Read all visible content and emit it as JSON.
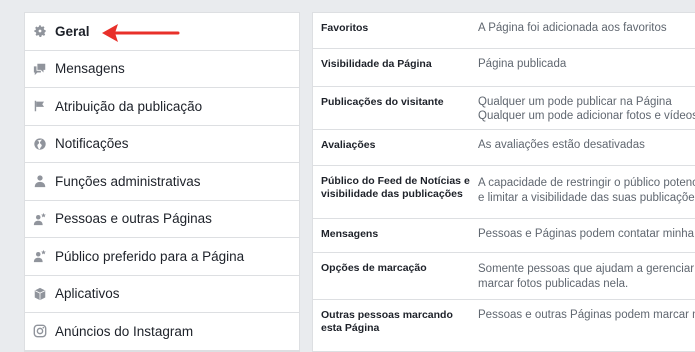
{
  "sidebar": {
    "items": [
      {
        "label": "Geral",
        "icon": "gear-icon",
        "active": true
      },
      {
        "label": "Mensagens",
        "icon": "chat-icon"
      },
      {
        "label": "Atribuição da publicação",
        "icon": "flag-icon"
      },
      {
        "label": "Notificações",
        "icon": "globe-icon"
      },
      {
        "label": "Funções administrativas",
        "icon": "person-icon"
      },
      {
        "label": "Pessoas e outras Páginas",
        "icon": "person-star-icon"
      },
      {
        "label": "Público preferido para a Página",
        "icon": "person-star-icon"
      },
      {
        "label": "Aplicativos",
        "icon": "cube-icon"
      },
      {
        "label": "Anúncios do Instagram",
        "icon": "instagram-icon"
      }
    ]
  },
  "settings": {
    "rows": [
      {
        "label": "Favoritos",
        "value": "A Página foi adicionada aos favoritos"
      },
      {
        "label": "Visibilidade da Página",
        "value": "Página publicada"
      },
      {
        "label": "Publicações do visitante",
        "value": "Qualquer um pode publicar na Página\nQualquer um pode adicionar fotos e vídeos"
      },
      {
        "label": "Avaliações",
        "value": "As avaliações estão desativadas"
      },
      {
        "label": "Público do Feed de Notícias e visibilidade das publicações",
        "value": "A capacidade de restringir o público potenc\ne limitar a visibilidade das suas publicaçõe"
      },
      {
        "label": "Mensagens",
        "value": "Pessoas e Páginas podem contatar minha P"
      },
      {
        "label": "Opções de marcação",
        "value": "Somente pessoas que ajudam a gerenciar m\nmarcar fotos publicadas nela."
      },
      {
        "label": "Outras pessoas marcando esta Página",
        "value": "Pessoas e outras Páginas podem marcar m"
      }
    ]
  },
  "colors": {
    "arrow": "#e8302a",
    "border": "#dddfe2",
    "muted": "#606770"
  }
}
